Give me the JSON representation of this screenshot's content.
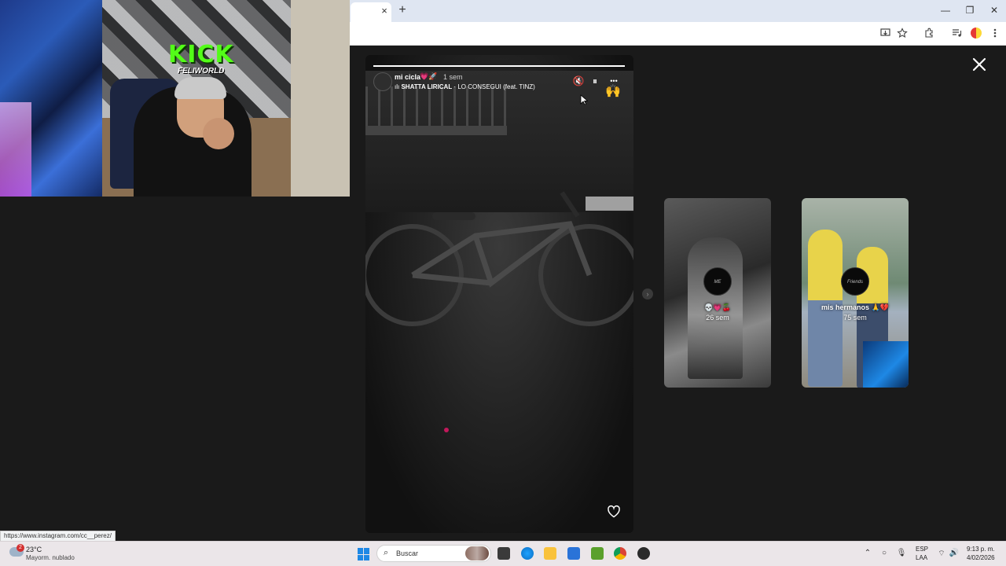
{
  "browser": {
    "tab_close": "×",
    "new_tab": "+",
    "win_min": "—",
    "win_max": "❐",
    "win_close": "✕"
  },
  "webcam": {
    "brand": "KICK",
    "channel": "FELIWORLD"
  },
  "story": {
    "progress": 1.0,
    "username": "mi cicla",
    "emoji": "💗🚀",
    "time": "1 sem",
    "music_icon": "ılı",
    "music_artist": "SHATTA LIRICAL",
    "music_title": " · LO CONSEGUI (feat. TINZ)",
    "mute_icon": "🔇",
    "pause_icon": "⏸",
    "more_icon": "•••",
    "sticker": "🙌"
  },
  "thumbs": [
    {
      "circle_text": "ME",
      "name": "💀💗🍒",
      "time": "26 sem"
    },
    {
      "circle_text": "Friends",
      "name": "mis hermanos 🙏💔",
      "time": "75 sem"
    }
  ],
  "next_icon": "›",
  "status_url": "https://www.instagram.com/cc__perez/",
  "taskbar": {
    "weather_badge": "2",
    "temp": "23°C",
    "condition": "Mayorm. nublado",
    "search_placeholder": "Buscar",
    "search_icon": "⌕",
    "lang_top": "ESP",
    "lang_bottom": "LAA",
    "time": "9:13 p. m.",
    "date": "4/02/2026",
    "tray_up": "⌃",
    "tray_wifi": "⌔",
    "tray_mic": "🎙",
    "tray_speaker": "🔊"
  },
  "colors": {
    "kick_green": "#53fc18",
    "accent_blue": "#1e88e5"
  }
}
